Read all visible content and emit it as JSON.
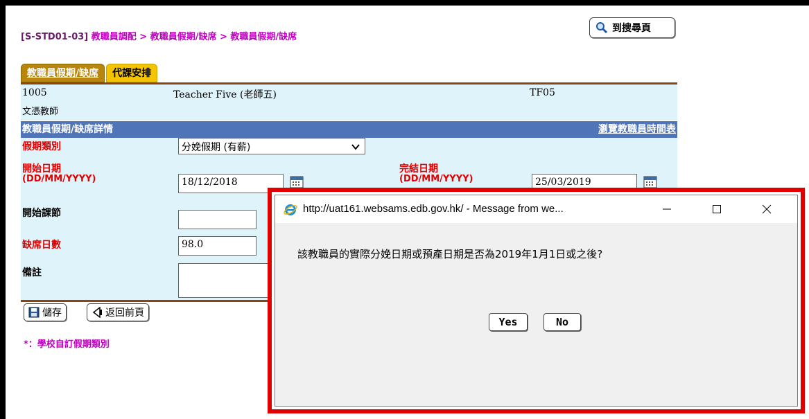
{
  "breadcrumb": {
    "code": "[S-STD01-03]",
    "path": "教職員調配 > 教職員假期/缺席 > 教職員假期/缺席"
  },
  "search_button": {
    "label": "到搜尋頁"
  },
  "tabs": [
    {
      "label": "教職員假期/缺席",
      "active": true
    },
    {
      "label": "代課安排",
      "active": false
    }
  ],
  "staff": {
    "id": "1005",
    "name": "Teacher Five (老師五)",
    "code": "TF05",
    "rank": "文憑教師"
  },
  "section": {
    "title": "教職員假期/缺席詳情",
    "link": "瀏覽教職員時間表"
  },
  "form": {
    "leave_type_label": "假期類別",
    "leave_type_value": "分娩假期 (有薪)",
    "start_date_label": "開始日期",
    "start_date_format": "(DD/MM/YYYY)",
    "start_date_value": "18/12/2018",
    "end_date_label": "完結日期",
    "end_date_format": "(DD/MM/YYYY)",
    "end_date_value": "25/03/2019",
    "start_period_label": "開始課節",
    "start_period_value": "",
    "absent_days_label": "缺席日數",
    "absent_days_value": "98.0",
    "remarks_label": "備註",
    "remarks_value": ""
  },
  "buttons": {
    "save": "儲存",
    "back": "返回前頁"
  },
  "footnote": "*：學校自訂假期類別",
  "dialog": {
    "title": "http://uat161.websams.edb.gov.hk/ - Message from we...",
    "message": "該教職員的實際分娩日期或預產日期是否為2019年1月1日或之後?",
    "yes": "Yes",
    "no": "No"
  },
  "colors": {
    "highlight_border": "#e00000",
    "section_bar": "#4f75b8",
    "form_bg": "#dff3fb",
    "tab_active": "#b8860b",
    "tab_inactive": "#f5c400"
  }
}
